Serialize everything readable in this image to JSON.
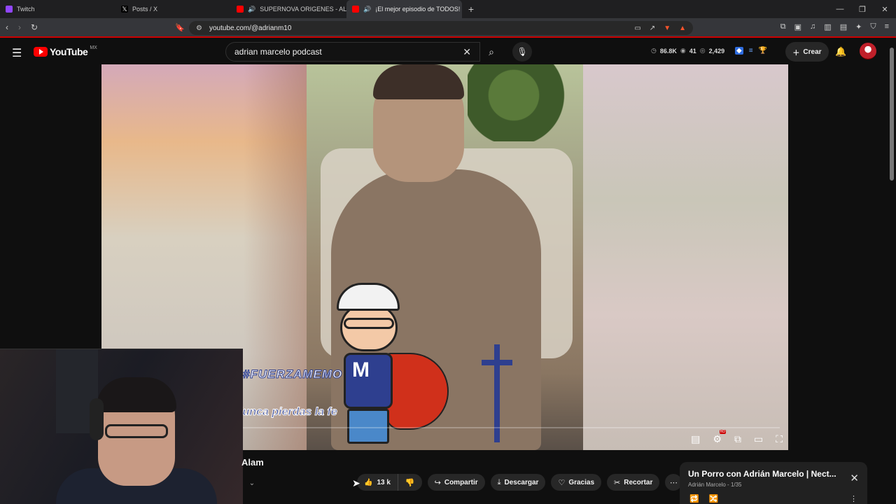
{
  "browser": {
    "tabs": [
      {
        "label": "Twitch",
        "fav_color": "#9146ff",
        "audio": false,
        "active": false
      },
      {
        "label": "Posts / X",
        "fav_color": "#000000",
        "audio": false,
        "active": false
      },
      {
        "label": "SUPERNOVA ORIGENES - ALANA",
        "fav_color": "#ff0000",
        "audio": true,
        "active": false
      },
      {
        "label": "¡El mejor episodio de TODOS!",
        "fav_color": "#ff0000",
        "audio": true,
        "active": true
      }
    ],
    "url": "youtube.com/@adrianm10"
  },
  "youtube": {
    "logo_text": "YouTube",
    "region": "MX",
    "search_value": "adrian marcelo podcast",
    "stats": {
      "views": "86.8K",
      "count": "41",
      "watchers": "2,429"
    },
    "create_label": "Crear"
  },
  "video": {
    "overlay_hashtag": "#FUERZAMEMO",
    "overlay_caption": "Nunca pierdas la fe",
    "sticker_letter": "M",
    "title_fragment": "Alam",
    "likes": "13 k",
    "progress": 0.0
  },
  "actions": {
    "share": "Compartir",
    "download": "Descargar",
    "thanks": "Gracias",
    "clip": "Recortar"
  },
  "playlist": {
    "title": "Un Porro con Adrián Marcelo | Nect...",
    "channel": "Adrián Marcelo",
    "position": "1/35"
  }
}
